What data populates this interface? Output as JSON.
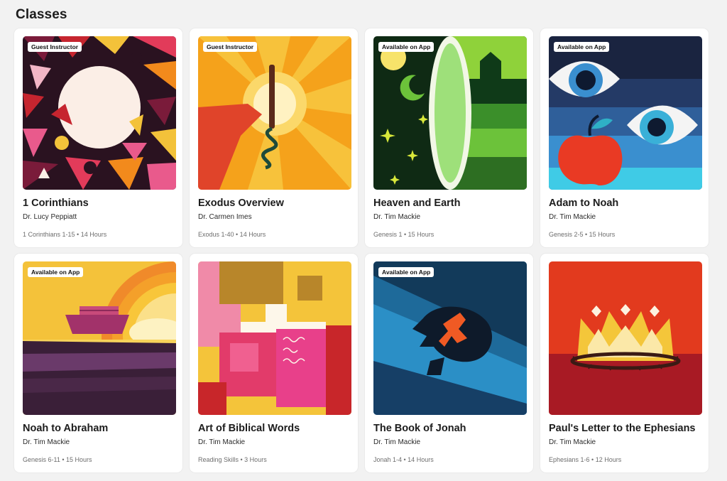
{
  "page": {
    "title": "Classes"
  },
  "classes": [
    {
      "title": "1 Corinthians",
      "instructor": "Dr. Lucy Peppiatt",
      "meta": "1 Corinthians 1-15 • 14 Hours",
      "badge": "Guest Instructor"
    },
    {
      "title": "Exodus Overview",
      "instructor": "Dr. Carmen Imes",
      "meta": "Exodus 1-40 • 14 Hours",
      "badge": "Guest Instructor"
    },
    {
      "title": "Heaven and Earth",
      "instructor": "Dr. Tim Mackie",
      "meta": "Genesis 1 • 15 Hours",
      "badge": "Available on App"
    },
    {
      "title": "Adam to Noah",
      "instructor": "Dr. Tim Mackie",
      "meta": "Genesis 2-5 • 15 Hours",
      "badge": "Available on App"
    },
    {
      "title": "Noah to Abraham",
      "instructor": "Dr. Tim Mackie",
      "meta": "Genesis 6-11 • 15 Hours",
      "badge": "Available on App"
    },
    {
      "title": "Art of Biblical Words",
      "instructor": "Dr. Tim Mackie",
      "meta": "Reading Skills • 3 Hours"
    },
    {
      "title": "The Book of Jonah",
      "instructor": "Dr. Tim Mackie",
      "meta": "Jonah 1-4 • 14 Hours",
      "badge": "Available on App"
    },
    {
      "title": "Paul's Letter to the Ephesians",
      "instructor": "Dr. Tim Mackie",
      "meta": "Ephesians 1-6 • 12 Hours"
    }
  ]
}
